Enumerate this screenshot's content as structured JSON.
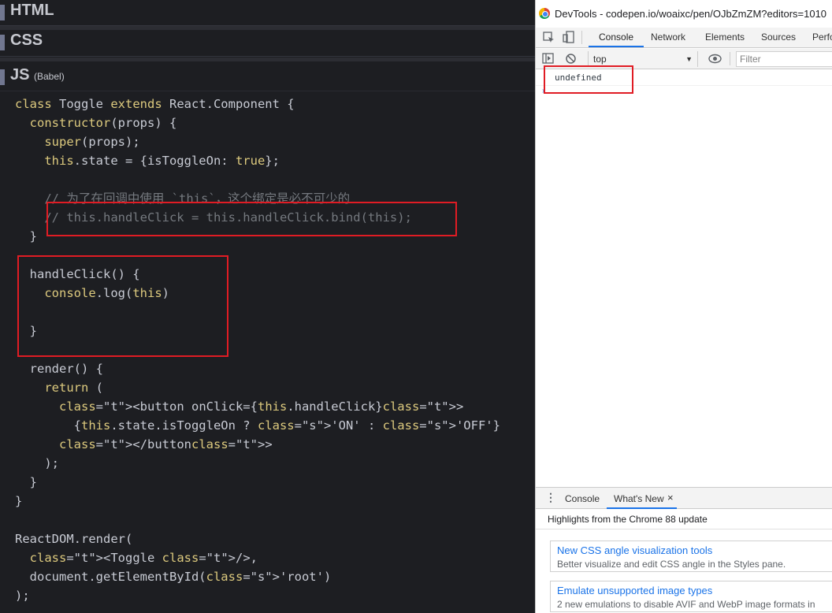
{
  "editor": {
    "sections": {
      "html": "HTML",
      "css": "CSS",
      "js": "JS",
      "js_preprocessor": "(Babel)"
    },
    "code_lines": [
      "class Toggle extends React.Component {",
      "  constructor(props) {",
      "    super(props);",
      "    this.state = {isToggleOn: true};",
      "",
      "    // 为了在回调中使用 `this`，这个绑定是必不可少的",
      "    // this.handleClick = this.handleClick.bind(this);",
      "  }",
      "",
      "  handleClick() {",
      "    console.log(this)",
      "",
      "  }",
      "",
      "  render() {",
      "    return (",
      "      <button onClick={this.handleClick}>",
      "        {this.state.isToggleOn ? 'ON' : 'OFF'}",
      "      </button>",
      "    );",
      "  }",
      "}",
      "",
      "ReactDOM.render(",
      "  <Toggle />,",
      "  document.getElementById('root')",
      ");"
    ]
  },
  "devtools": {
    "window_title": "DevTools - codepen.io/woaixc/pen/OJbZmZM?editors=1010",
    "tabs": [
      "Console",
      "Network",
      "Elements",
      "Sources",
      "Perfo"
    ],
    "active_tab": "Console",
    "context_select": "top",
    "filter_placeholder": "Filter",
    "console_output": [
      "undefined"
    ],
    "drawer": {
      "tabs": [
        "Console",
        "What's New"
      ],
      "active_tab": "What's New",
      "close_glyph": "×",
      "heading": "Highlights from the Chrome 88 update",
      "items": [
        {
          "title": "New CSS angle visualization tools",
          "desc": "Better visualize and edit CSS angle in the Styles pane."
        },
        {
          "title": "Emulate unsupported image types",
          "desc": "2 new emulations to disable AVIF and WebP image formats in"
        }
      ]
    },
    "icons": [
      "inspect-icon",
      "device-toolbar-icon",
      "sidebar-toggle-icon",
      "clear-console-icon",
      "eye-icon",
      "drawer-menu-icon"
    ]
  },
  "colors": {
    "editor_bg": "#1d1e22",
    "keyword": "#ddca7e",
    "comment": "#75797f",
    "highlight_box": "#e01c24",
    "devtools_accent": "#1a73e8"
  }
}
